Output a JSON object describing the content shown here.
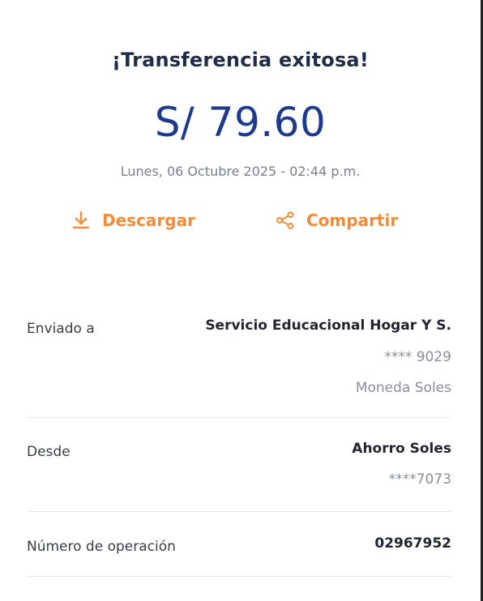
{
  "header": {
    "title": "¡Transferencia exitosa!",
    "amount": "S/ 79.60",
    "datetime": "Lunes, 06 Octubre 2025 - 02:44 p.m."
  },
  "actions": {
    "download_label": "Descargar",
    "download_icon": "download-icon",
    "share_label": "Compartir",
    "share_icon": "share-icon"
  },
  "details": {
    "sent_to": {
      "label": "Enviado a",
      "name": "Servicio Educacional Hogar Y S.",
      "account": "**** 9029",
      "currency": "Moneda Soles"
    },
    "from": {
      "label": "Desde",
      "account_type": "Ahorro Soles",
      "account": "****7073"
    },
    "operation": {
      "label": "Número de operación",
      "number": "02967952"
    }
  },
  "colors": {
    "accent": "#f08c3a",
    "amount": "#1e3a8c",
    "title": "#1f2d49",
    "divider": "#e3e5e8"
  }
}
